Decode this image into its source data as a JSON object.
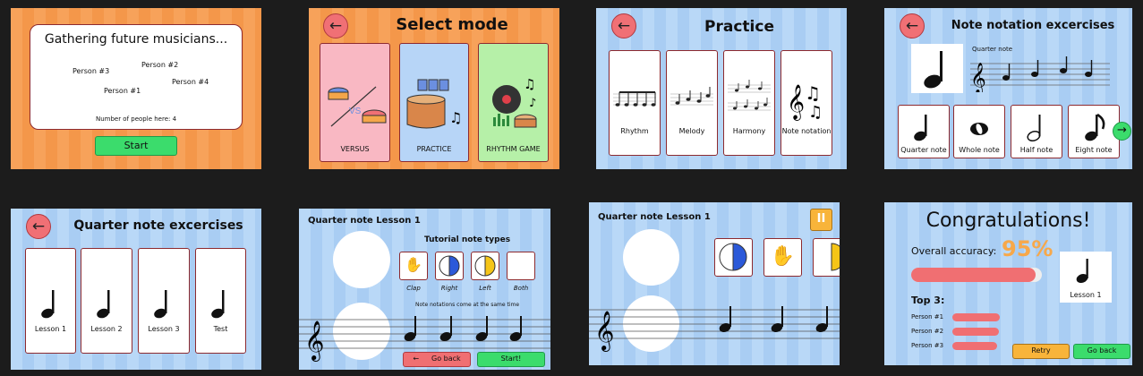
{
  "gather": {
    "title": "Gathering future musicians...",
    "people": [
      "Person #3",
      "Person #2",
      "Person #4",
      "Person #1"
    ],
    "count": "Number of people here: 4",
    "start": "Start"
  },
  "mode": {
    "title": "Select mode",
    "options": [
      "VERSUS",
      "PRACTICE",
      "RHYTHM GAME"
    ],
    "vs": "VS"
  },
  "practice": {
    "title": "Practice",
    "options": [
      "Rhythm",
      "Melody",
      "Harmony",
      "Note notation"
    ]
  },
  "notation": {
    "title": "Note notation excercises",
    "caption": "Quarter note",
    "options": [
      "Quarter note",
      "Whole note",
      "Half note",
      "Eight note"
    ]
  },
  "quarter": {
    "title": "Quarter note excercises",
    "lessons": [
      "Lesson 1",
      "Lesson 2",
      "Lesson 3",
      "Test"
    ]
  },
  "tutorial": {
    "title": "Quarter note Lesson 1",
    "types_title": "Tutorial note types",
    "types": [
      "Clap",
      "Right",
      "Left",
      "Both"
    ],
    "hint": "Note notations come at the same time",
    "goback": "Go back",
    "start": "Start!"
  },
  "game": {
    "title": "Quarter note Lesson 1",
    "pause": "II"
  },
  "congrats": {
    "title": "Congratulations!",
    "accuracy_label": "Overall accuracy:",
    "accuracy": "95%",
    "accuracy_value": 0.95,
    "lesson": "Lesson 1",
    "top_title": "Top 3:",
    "top": [
      "Person #1",
      "Person #2",
      "Person #3"
    ],
    "retry": "Retry",
    "goback": "Go back"
  }
}
